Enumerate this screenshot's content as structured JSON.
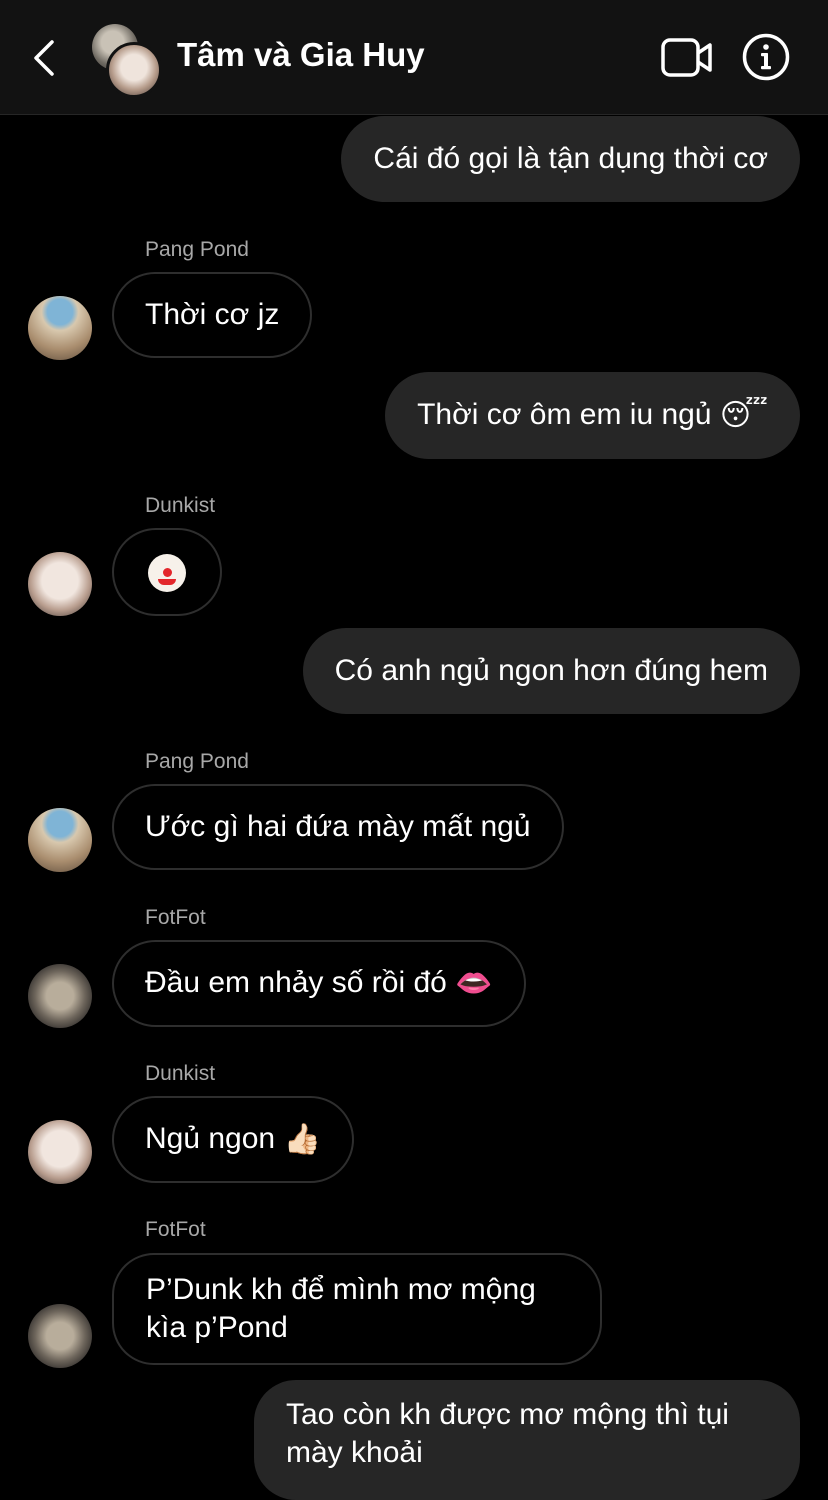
{
  "header": {
    "title": "Tâm và Gia Huy",
    "icons": [
      "chevron-left-icon",
      "video-call-icon",
      "info-icon"
    ]
  },
  "messages": [
    {
      "direction": "outgoing",
      "text": "Cái đó gọi là tận dụng thời cơ"
    },
    {
      "direction": "incoming",
      "sender": "Pang Pond",
      "text": "Thời cơ jz"
    },
    {
      "direction": "outgoing",
      "text": "Thời cơ ôm em iu ngủ",
      "emoji": "😴"
    },
    {
      "direction": "incoming",
      "sender": "Dunkist",
      "emoji": "🤡"
    },
    {
      "direction": "outgoing",
      "text": "Có anh ngủ ngon hơn đúng hem"
    },
    {
      "direction": "incoming",
      "sender": "Pang Pond",
      "text": "Ước gì hai đứa mày mất ngủ"
    },
    {
      "direction": "incoming",
      "sender": "FotFot",
      "text": "Đầu em nhảy số rồi đó",
      "emoji": "👄"
    },
    {
      "direction": "incoming",
      "sender": "Dunkist",
      "text": "Ngủ ngon",
      "emoji": "👍🏻"
    },
    {
      "direction": "incoming",
      "sender": "FotFot",
      "lines": [
        "P’Dunk kh để mình mơ mộng",
        "kìa p’Pond"
      ]
    },
    {
      "direction": "outgoing",
      "lines": [
        "Tao còn kh được mơ mộng thì tụi",
        "mày khoải"
      ]
    }
  ]
}
